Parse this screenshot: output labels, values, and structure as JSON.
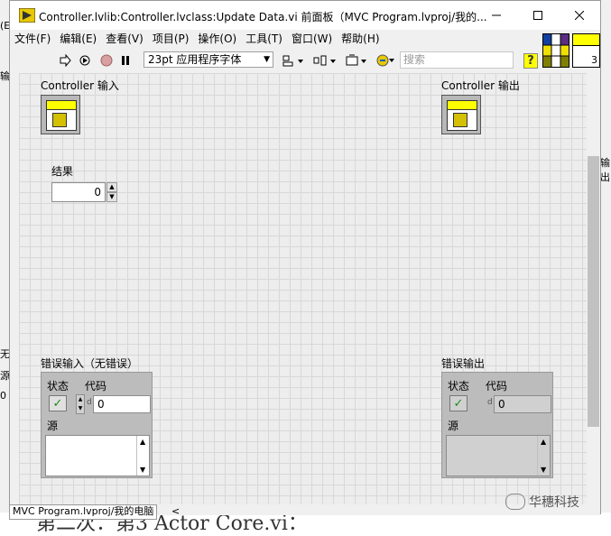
{
  "window": {
    "title": "Controller.lvlib:Controller.lvclass:Update Data.vi 前面板（MVC Program.lvproj/我的...",
    "minimize_icon": "minimize-icon",
    "maximize_icon": "maximize-icon",
    "close_icon": "close-icon"
  },
  "menu": {
    "items": [
      "文件(F)",
      "编辑(E)",
      "查看(V)",
      "项目(P)",
      "操作(O)",
      "工具(T)",
      "窗口(W)",
      "帮助(H)"
    ]
  },
  "toolbar": {
    "font": "23pt 应用程序字体",
    "search_placeholder": "搜索",
    "help": "?",
    "connector_count": "3"
  },
  "panel": {
    "controller_in_label": "Controller 输入",
    "controller_out_label": "Controller 输出",
    "result_label": "结果",
    "result_value": "0",
    "error_in_label": "错误输入（无错误）",
    "error_out_label": "错误输出",
    "status_label": "状态",
    "code_label": "代码",
    "source_label": "源",
    "code_in_value": "0",
    "code_out_value": "0",
    "code_prefix": "d"
  },
  "statusbar": {
    "project_context": "MVC Program.lvproj/我的电脑"
  },
  "background": {
    "left_fragments": [
      "(E",
      "输",
      "无",
      "源",
      "0"
    ],
    "right_fragment": "输出",
    "bottom_text": "第二次：第3 Actor Core.vi：",
    "watermark": "华穗科技"
  }
}
